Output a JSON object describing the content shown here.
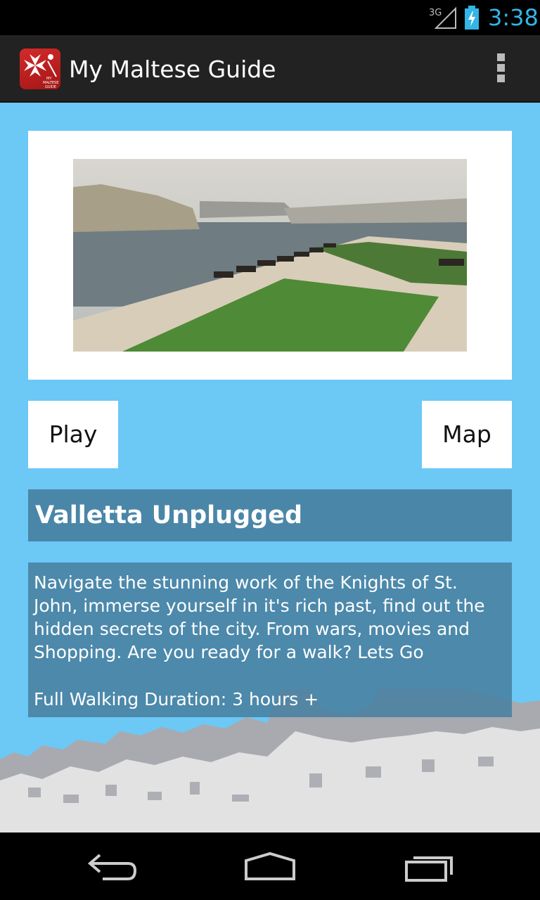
{
  "status_bar": {
    "network": "3G",
    "time": "3:38"
  },
  "app_bar": {
    "title": "My Maltese Guide",
    "icon": "my-maltese-guide-app-icon",
    "menu_icon": "overflow-menu-icon"
  },
  "tour": {
    "image": "saluting-battery-photo",
    "play_label": "Play",
    "map_label": "Map",
    "title": "Valletta Unplugged",
    "description": "Navigate the stunning work of the Knights of St. John, immerse yourself in it's rich past, find out the hidden secrets of the city. From wars, movies and Shopping. Are you ready for a walk? Lets Go",
    "duration": "Full Walking Duration: 3 hours +"
  },
  "nav_bar": {
    "back_icon": "back-icon",
    "home_icon": "home-icon",
    "recent_icon": "recent-apps-icon"
  },
  "colors": {
    "background": "#6cc8f5",
    "panel": "#4880a0",
    "accent": "#33b5e5",
    "action_bar": "#222222"
  }
}
